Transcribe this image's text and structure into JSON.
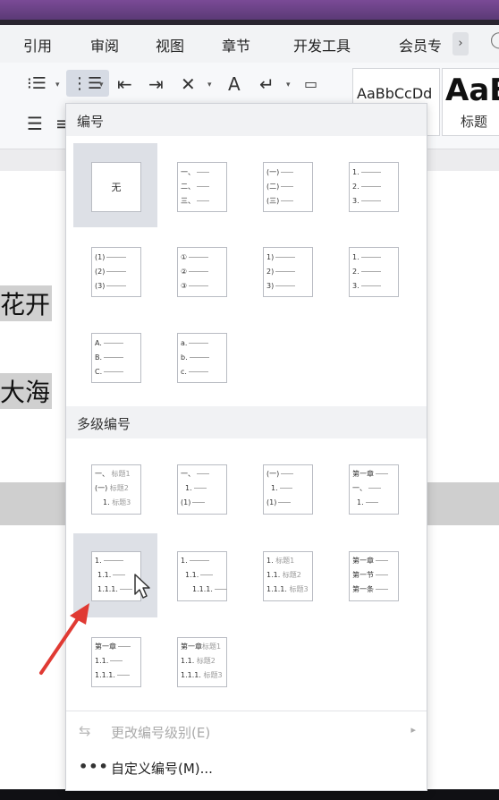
{
  "menu_tabs": [
    "引用",
    "审阅",
    "视图",
    "章节",
    "开发工具",
    "会员专"
  ],
  "menu_scroll": "›",
  "search_icon": "search-icon",
  "ribbon": {
    "style_normal_sample": "AaBbCcDd",
    "style_heading_sample": "AaB",
    "style_heading_label": "标题"
  },
  "document": {
    "lines": [
      "花开",
      "大海"
    ]
  },
  "numbering_panel": {
    "section_numbering": "编号",
    "none_label": "无",
    "section_multilevel": "多级编号",
    "change_level": "更改编号级别(E)",
    "custom_numbering": "自定义编号(M)...",
    "items": {
      "cn": [
        "一、",
        "二、",
        "三、"
      ],
      "cnp": [
        "(一)",
        "(二)",
        "(三)"
      ],
      "dec": [
        "1.",
        "2.",
        "3."
      ],
      "par": [
        "(1)",
        "(2)",
        "(3)"
      ],
      "circ": [
        "①",
        "②",
        "③"
      ],
      "rpar": [
        "1)",
        "2)",
        "3)"
      ],
      "upper": [
        "A.",
        "B.",
        "C."
      ],
      "lower": [
        "a.",
        "b.",
        "c."
      ]
    },
    "multilevel": {
      "m1": [
        "一、",
        "(一)",
        "1.",
        "标题1",
        "标题2",
        "标题3"
      ],
      "m2": [
        "一、",
        "1.",
        "(1)"
      ],
      "m3": [
        "(一)",
        "1.",
        "(1)"
      ],
      "m4": [
        "第一章",
        "一、",
        "1."
      ],
      "m5": [
        "1.",
        "1.1.",
        "1.1.1."
      ],
      "m6": [
        "1.",
        "1.1.",
        "1.1.1."
      ],
      "m7": [
        "1.",
        "1.1.",
        "1.1.1.",
        "标题1",
        "标题2",
        "标题3"
      ],
      "m8": [
        "第一章",
        "第一节",
        "第一条"
      ],
      "m9": [
        "第一章",
        "1.1.",
        "1.1.1."
      ],
      "m10": [
        "第一章",
        "1.1.",
        "1.1.1.",
        "标题1",
        "标题2",
        "标题3"
      ]
    }
  },
  "colors": {
    "accent_selected": "#d6dbe4",
    "hover_option": "#dde0e6",
    "annotation_arrow": "#e03a33"
  }
}
